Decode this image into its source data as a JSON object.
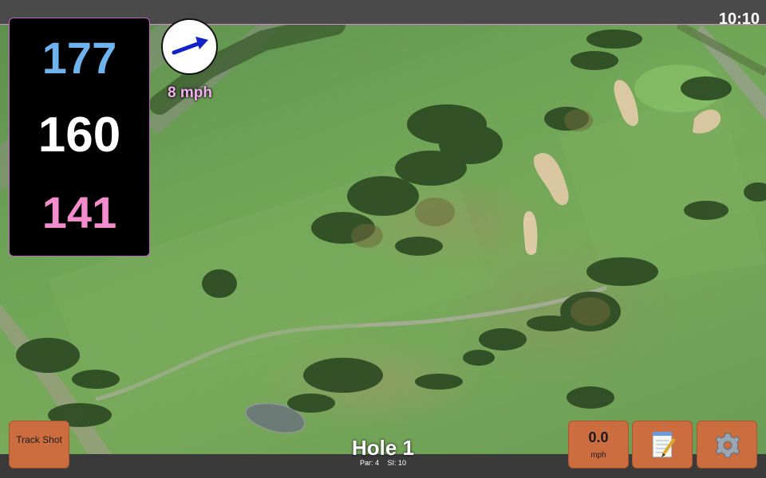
{
  "status_bar": {
    "time": "10:10"
  },
  "distances": {
    "back": "177",
    "middle": "160",
    "front": "141"
  },
  "wind": {
    "speed_text": "8 mph",
    "arrow_icon": "arrow-right-icon"
  },
  "hole": {
    "title": "Hole 1",
    "par": "Par: 4",
    "si": "SI: 10"
  },
  "buttons": {
    "track_shot": "Track Shot",
    "speed_value": "0.0",
    "speed_unit": "mph",
    "notes_icon": "notepad-icon",
    "settings_icon": "gear-icon"
  },
  "colors": {
    "back": "#6fb3ee",
    "middle": "#ffffff",
    "front": "#f28ccb",
    "button": "#cc6d3f",
    "wind_text": "#f4b3f0",
    "panel_border": "#c35ec9"
  }
}
